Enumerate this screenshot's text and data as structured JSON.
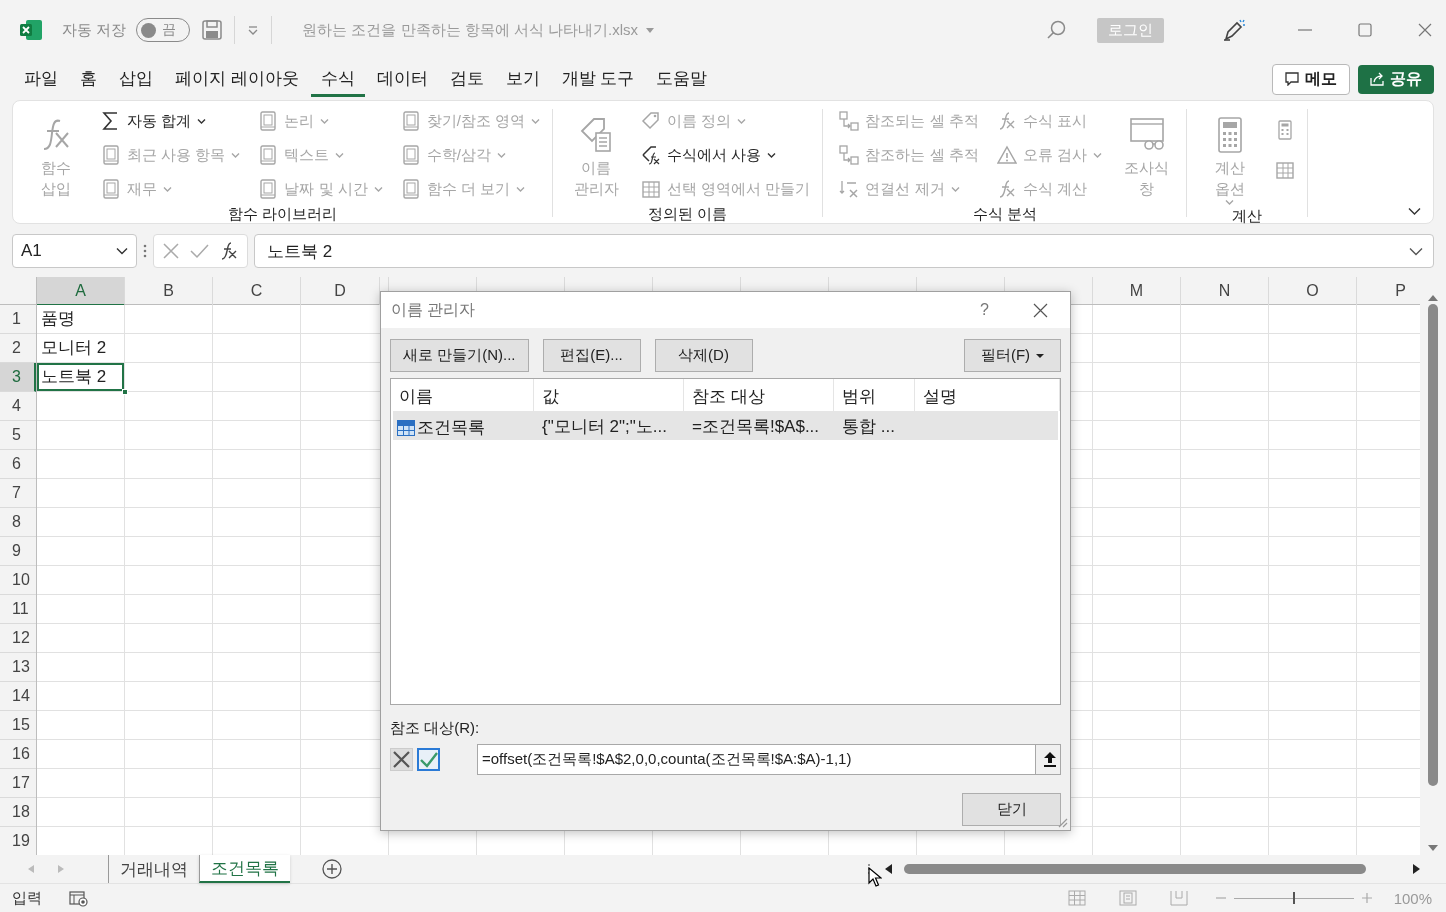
{
  "titlebar": {
    "autosave_label": "자동 저장",
    "autosave": {
      "on": false,
      "label": "끔"
    },
    "file_name": "원하는 조건을 만족하는 항목에 서식 나타내기.xlsx",
    "login": "로그인"
  },
  "menubar": {
    "tabs": [
      {
        "label": "파일",
        "selected": false
      },
      {
        "label": "홈",
        "selected": false
      },
      {
        "label": "삽입",
        "selected": false
      },
      {
        "label": "페이지 레이아웃",
        "selected": false
      },
      {
        "label": "수식",
        "selected": true
      },
      {
        "label": "데이터",
        "selected": false
      },
      {
        "label": "검토",
        "selected": false
      },
      {
        "label": "보기",
        "selected": false
      },
      {
        "label": "개발 도구",
        "selected": false
      },
      {
        "label": "도움말",
        "selected": false
      }
    ],
    "memo": "메모",
    "share": "공유"
  },
  "ribbon": {
    "groups": [
      {
        "label": "함수 라이브러리",
        "columns": [
          {
            "items": [
              {
                "kind": "large",
                "label": "함수 삽입",
                "disabled": true,
                "dropdown": false
              }
            ]
          },
          {
            "items": [
              {
                "kind": "small",
                "label": "자동 합계",
                "disabled": false,
                "dropdown": true
              },
              {
                "kind": "small",
                "label": "최근 사용 항목",
                "disabled": true,
                "dropdown": true
              },
              {
                "kind": "small",
                "label": "재무",
                "disabled": true,
                "dropdown": true
              }
            ]
          },
          {
            "items": [
              {
                "kind": "small",
                "label": "논리",
                "disabled": true,
                "dropdown": true
              },
              {
                "kind": "small",
                "label": "텍스트",
                "disabled": true,
                "dropdown": true
              },
              {
                "kind": "small",
                "label": "날짜 및 시간",
                "disabled": true,
                "dropdown": true
              }
            ]
          },
          {
            "items": [
              {
                "kind": "small",
                "label": "찾기/참조 영역",
                "disabled": true,
                "dropdown": true
              },
              {
                "kind": "small",
                "label": "수학/삼각",
                "disabled": true,
                "dropdown": true
              },
              {
                "kind": "small",
                "label": "함수 더 보기",
                "disabled": true,
                "dropdown": true
              }
            ]
          }
        ]
      },
      {
        "label": "정의된 이름",
        "columns": [
          {
            "items": [
              {
                "kind": "large",
                "label": "이름 관리자",
                "disabled": true,
                "dropdown": false
              }
            ]
          },
          {
            "items": [
              {
                "kind": "small",
                "label": "이름 정의",
                "disabled": true,
                "dropdown": true
              },
              {
                "kind": "small",
                "label": "수식에서 사용",
                "disabled": false,
                "dropdown": true
              },
              {
                "kind": "small",
                "label": "선택 영역에서 만들기",
                "disabled": true,
                "dropdown": false
              }
            ]
          }
        ]
      },
      {
        "label": "수식 분석",
        "columns": [
          {
            "items": [
              {
                "kind": "small",
                "label": "참조되는 셀 추적",
                "disabled": true,
                "dropdown": false
              },
              {
                "kind": "small",
                "label": "참조하는 셀 추적",
                "disabled": true,
                "dropdown": false
              },
              {
                "kind": "small",
                "label": "연결선 제거",
                "disabled": true,
                "dropdown": true
              }
            ]
          },
          {
            "items": [
              {
                "kind": "small",
                "label": "수식 표시",
                "disabled": true,
                "dropdown": false
              },
              {
                "kind": "small",
                "label": "오류 검사",
                "disabled": true,
                "dropdown": true
              },
              {
                "kind": "small",
                "label": "수식 계산",
                "disabled": true,
                "dropdown": false
              }
            ]
          },
          {
            "items": [
              {
                "kind": "large",
                "label": "조사식 창",
                "disabled": true,
                "dropdown": false
              }
            ]
          }
        ]
      },
      {
        "label": "계산",
        "columns": [
          {
            "items": [
              {
                "kind": "large",
                "label": "계산 옵션",
                "disabled": true,
                "dropdown": true
              }
            ]
          },
          {
            "items": [
              {
                "kind": "icon",
                "disabled": true
              },
              {
                "kind": "icon",
                "disabled": true
              }
            ]
          }
        ]
      }
    ]
  },
  "formula_bar": {
    "name_box": "A1",
    "value": "노트북 2"
  },
  "grid": {
    "columns": [
      {
        "label": "A",
        "selected": true
      },
      {
        "label": "B",
        "selected": false
      },
      {
        "label": "C",
        "selected": false
      },
      {
        "label": "D",
        "selected": false
      },
      {
        "label": "M",
        "selected": false
      },
      {
        "label": "N",
        "selected": false
      },
      {
        "label": "O",
        "selected": false
      },
      {
        "label": "P",
        "selected": false
      }
    ],
    "rows": [
      {
        "label": "1",
        "selected": false,
        "cells": [
          {
            "text": "품명",
            "active": false
          }
        ]
      },
      {
        "label": "2",
        "selected": false,
        "cells": [
          {
            "text": "모니터 2",
            "active": false
          }
        ]
      },
      {
        "label": "3",
        "selected": true,
        "cells": [
          {
            "text": "노트북 2",
            "active": true
          }
        ]
      },
      {
        "label": "4",
        "selected": false
      },
      {
        "label": "5",
        "selected": false
      },
      {
        "label": "6",
        "selected": false
      },
      {
        "label": "7",
        "selected": false
      },
      {
        "label": "8",
        "selected": false
      },
      {
        "label": "9",
        "selected": false
      },
      {
        "label": "10",
        "selected": false
      },
      {
        "label": "11",
        "selected": false
      },
      {
        "label": "12",
        "selected": false
      },
      {
        "label": "13",
        "selected": false
      },
      {
        "label": "14",
        "selected": false
      },
      {
        "label": "15",
        "selected": false
      },
      {
        "label": "16",
        "selected": false
      },
      {
        "label": "17",
        "selected": false
      },
      {
        "label": "18",
        "selected": false
      },
      {
        "label": "19",
        "selected": false
      }
    ]
  },
  "dialog": {
    "title": "이름 관리자",
    "help": "?",
    "buttons": [
      "새로 만들기(N)...",
      "편집(E)...",
      "삭제(D)"
    ],
    "filter": "필터(F)",
    "columns": [
      "이름",
      "값",
      "참조 대상",
      "범위",
      "설명"
    ],
    "rows": [
      {
        "selected": true,
        "cells": [
          "조건목록",
          "{\"모니터 2\";\"노...",
          "=조건목록!$A$...",
          "통합 ..."
        ]
      }
    ],
    "refers_label": "참조 대상(R):",
    "refers_value": "=offset(조건목록!$A$2,0,0,counta(조건목록!$A:$A)-1,1)",
    "close": "닫기"
  },
  "sheet_tabs": [
    {
      "label": "거래내역",
      "selected": false
    },
    {
      "label": "조건목록",
      "selected": true
    }
  ],
  "status_bar": {
    "mode": "입력",
    "zoom_slider": {
      "level": 0.5
    },
    "zoom": "100%"
  }
}
